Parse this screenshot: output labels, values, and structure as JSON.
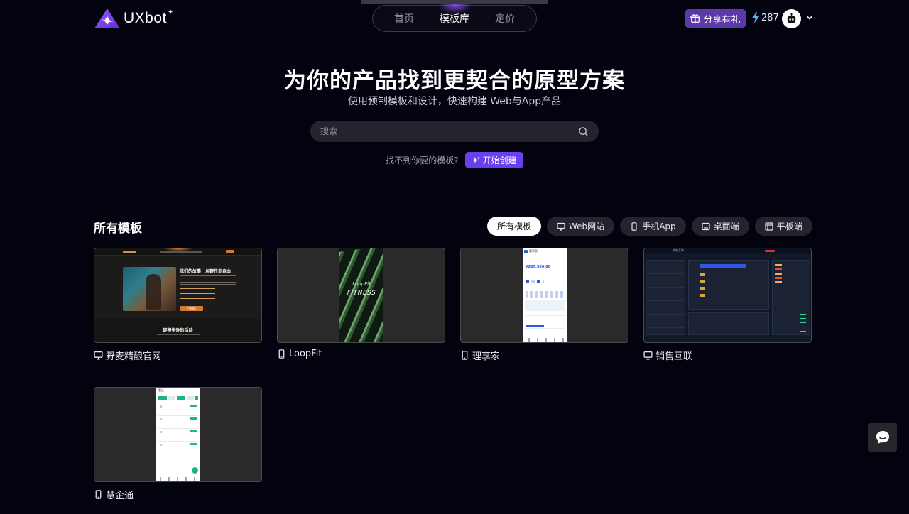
{
  "header": {
    "logo_text": "UXbot",
    "logo_star": "✦",
    "nav": [
      {
        "label": "首页",
        "active": false
      },
      {
        "label": "模板库",
        "active": true
      },
      {
        "label": "定价",
        "active": false
      }
    ],
    "share_label": "分享有礼",
    "credits": "287",
    "accent_color": "#6b3ff0"
  },
  "hero": {
    "title": "为你的产品找到更契合的原型方案",
    "subtitle": "使用预制模板和设计，快速构建 Web与App产品",
    "search_placeholder": "搜索",
    "cta_prompt": "找不到你要的模板?",
    "cta_button": "开始创建"
  },
  "templates": {
    "title": "所有模板",
    "filters": [
      {
        "label": "所有模板",
        "icon": "none",
        "active": true
      },
      {
        "label": "Web网站",
        "icon": "monitor-icon",
        "active": false
      },
      {
        "label": "手机App",
        "icon": "phone-icon",
        "active": false
      },
      {
        "label": "桌面端",
        "icon": "desktop-icon",
        "active": false
      },
      {
        "label": "平板端",
        "icon": "tablet-icon",
        "active": false
      }
    ],
    "cards": [
      {
        "name": "野麦精酿官网",
        "icon": "monitor-icon",
        "preview": {
          "heading": "我们的故事：从野性到自由",
          "section": "即将举办的活动",
          "button": "了解我们"
        }
      },
      {
        "name": "LoopFit",
        "icon": "phone-icon",
        "preview": {
          "line1": "LoopFit",
          "line2": "FITNESS"
        }
      },
      {
        "name": "理享家",
        "icon": "phone-icon",
        "preview": {
          "amount": "¥287,550.80",
          "header": "理享家"
        }
      },
      {
        "name": "销售互联",
        "icon": "monitor-icon",
        "preview": {
          "header": "销售互联"
        }
      },
      {
        "name": "慧企通",
        "icon": "phone-icon",
        "preview": {
          "header": "慧企"
        }
      }
    ]
  }
}
